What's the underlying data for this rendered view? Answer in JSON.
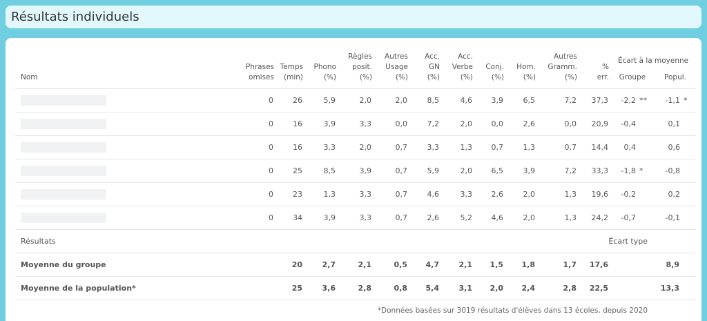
{
  "header": {
    "title": "Résultats individuels"
  },
  "table": {
    "columns": {
      "name": "Nom",
      "phrases": [
        "Phrases",
        "omises"
      ],
      "temps": [
        "Temps",
        "(min)"
      ],
      "phono": [
        "Phono",
        "(%)"
      ],
      "regles": [
        "Règles",
        "posit.",
        "(%)"
      ],
      "autres_usage": [
        "Autres",
        "Usage",
        "(%)"
      ],
      "acc_gn": [
        "Acc.",
        "GN",
        "(%)"
      ],
      "acc_verbe": [
        "Acc.",
        "Verbe",
        "(%)"
      ],
      "conj": [
        "Conj.",
        "(%)"
      ],
      "hom": [
        "Hom.",
        "(%)"
      ],
      "autres_gramm": [
        "Autres",
        "Gramm.",
        "(%)"
      ],
      "err": [
        "%",
        "err."
      ],
      "ecart": "Écart à la moyenne",
      "groupe": "Groupe",
      "popul": "Popul."
    },
    "rows": [
      {
        "phrases": "0",
        "temps": "26",
        "phono": "5,9",
        "regles": "2,0",
        "usage": "2,0",
        "gn": "8,5",
        "verbe": "4,6",
        "conj": "3,9",
        "hom": "6,5",
        "gramm": "7,2",
        "err": "37,3",
        "groupe": "-2,2",
        "groupe_sig": "**",
        "popul": "-1,1",
        "popul_sig": "*"
      },
      {
        "phrases": "0",
        "temps": "16",
        "phono": "3,9",
        "regles": "3,3",
        "usage": "0,0",
        "gn": "7,2",
        "verbe": "2,0",
        "conj": "0,0",
        "hom": "2,6",
        "gramm": "0,0",
        "err": "20,9",
        "groupe": "-0,4",
        "groupe_sig": "",
        "popul": "0,1",
        "popul_sig": ""
      },
      {
        "phrases": "0",
        "temps": "16",
        "phono": "3,3",
        "regles": "2,0",
        "usage": "0,7",
        "gn": "3,3",
        "verbe": "1,3",
        "conj": "0,7",
        "hom": "1,3",
        "gramm": "0,7",
        "err": "14,4",
        "groupe": "0,4",
        "groupe_sig": "",
        "popul": "0,6",
        "popul_sig": ""
      },
      {
        "phrases": "0",
        "temps": "25",
        "phono": "8,5",
        "regles": "3,9",
        "usage": "0,7",
        "gn": "5,9",
        "verbe": "2,0",
        "conj": "6,5",
        "hom": "3,9",
        "gramm": "7,2",
        "err": "33,3",
        "groupe": "-1,8",
        "groupe_sig": "*",
        "popul": "-0,8",
        "popul_sig": ""
      },
      {
        "phrases": "0",
        "temps": "23",
        "phono": "1,3",
        "regles": "3,3",
        "usage": "0,7",
        "gn": "4,6",
        "verbe": "3,3",
        "conj": "2,6",
        "hom": "2,0",
        "gramm": "1,3",
        "err": "19,6",
        "groupe": "-0,2",
        "groupe_sig": "",
        "popul": "0,2",
        "popul_sig": ""
      },
      {
        "phrases": "0",
        "temps": "34",
        "phono": "3,9",
        "regles": "3,3",
        "usage": "0,7",
        "gn": "2,6",
        "verbe": "5,2",
        "conj": "4,6",
        "hom": "2,0",
        "gramm": "1,3",
        "err": "24,2",
        "groupe": "-0,7",
        "groupe_sig": "",
        "popul": "-0,1",
        "popul_sig": ""
      }
    ],
    "results": {
      "label": "Résultats",
      "ecart_type": "Écart type"
    },
    "group_mean": {
      "label": "Moyenne du groupe",
      "temps": "20",
      "phono": "2,7",
      "regles": "2,1",
      "usage": "0,5",
      "gn": "4,7",
      "verbe": "2,1",
      "conj": "1,5",
      "hom": "1,8",
      "gramm": "1,7",
      "err": "17,6",
      "ecart": "8,9"
    },
    "pop_mean": {
      "label": "Moyenne de la population*",
      "temps": "25",
      "phono": "3,6",
      "regles": "2,8",
      "usage": "0,8",
      "gn": "5,4",
      "verbe": "3,1",
      "conj": "2,0",
      "hom": "2,4",
      "gramm": "2,8",
      "err": "22,5",
      "ecart": "13,3"
    }
  },
  "footnote": "*Données basées sur 3019 résultats d'élèves dans 13 écoles, depuis 2020"
}
